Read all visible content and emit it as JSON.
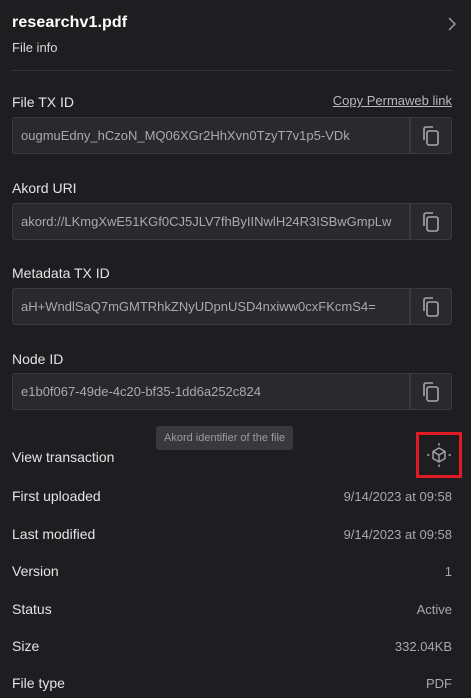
{
  "header": {
    "file_name": "researchv1.pdf",
    "subtitle": "File info"
  },
  "copy_permaweb_link": "Copy Permaweb link",
  "fields": {
    "file_tx_id": {
      "label": "File TX ID",
      "value": "ougmuEdny_hCzoN_MQ06XGr2HhXvn0TzyT7v1p5-VDk"
    },
    "akord_uri": {
      "label": "Akord URI",
      "value": "akord://LKmgXwE51KGf0CJ5JLV7fhByIINwlH24R3ISBwGmpLw"
    },
    "metadata_tx_id": {
      "label": "Metadata TX ID",
      "value": "aH+WndlSaQ7mGMTRhkZNyUDpnUSD4nxiww0cxFKcmS4="
    },
    "node_id": {
      "label": "Node ID",
      "value": "e1b0f067-49de-4c20-bf35-1dd6a252c824"
    }
  },
  "tooltip": "Akord identifier of the file",
  "view_transaction": {
    "label": "View transaction",
    "icon": "cube-icon"
  },
  "info": {
    "first_uploaded": {
      "label": "First uploaded",
      "value": "9/14/2023 at 09:58"
    },
    "last_modified": {
      "label": "Last modified",
      "value": "9/14/2023 at 09:58"
    },
    "version": {
      "label": "Version",
      "value": "1"
    },
    "status": {
      "label": "Status",
      "value": "Active"
    },
    "size": {
      "label": "Size",
      "value": "332.04KB"
    },
    "file_type": {
      "label": "File type",
      "value": "PDF"
    }
  },
  "colors": {
    "background": "#1e1e21",
    "highlight_box": "#e01b24",
    "icon_accent": "#a6a6ac"
  }
}
